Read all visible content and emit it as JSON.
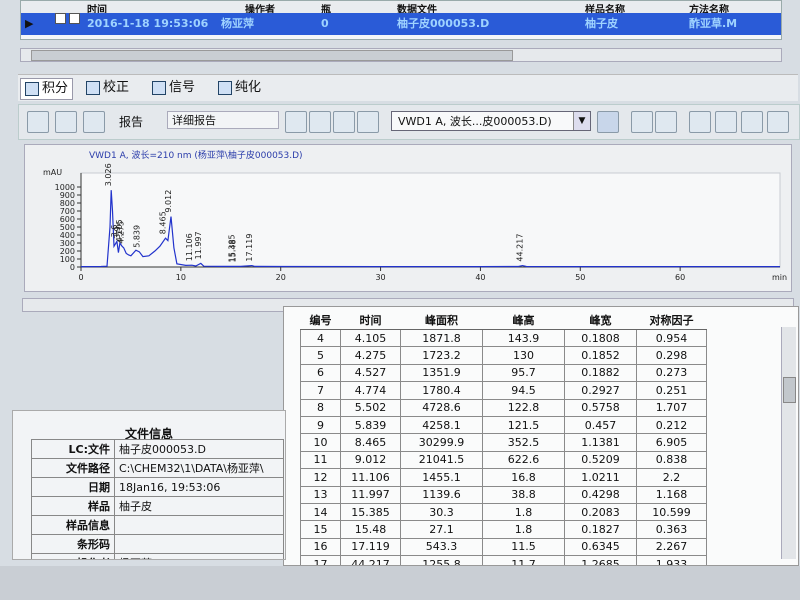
{
  "top_table": {
    "headers": [
      "时间",
      "操作者",
      "瓶",
      "数据文件",
      "样品名称",
      "方法名称"
    ],
    "row": {
      "time": "2016-1-18 19:53:06",
      "operator": "杨亚萍",
      "vial": "0",
      "file": "柚子皮000053.D",
      "sample": "柚子皮",
      "method": "酢亚草.M"
    }
  },
  "tabs": [
    {
      "label": "积分"
    },
    {
      "label": "校正"
    },
    {
      "label": "信号"
    },
    {
      "label": "纯化"
    }
  ],
  "toolbar": {
    "report_label": "报告",
    "report_value": "详细报告",
    "signal_value": "VWD1 A, 波长...皮000053.D)"
  },
  "chart_data": {
    "type": "line",
    "title": "VWD1 A, 波长=210 nm (杨亚萍\\柚子皮000053.D)",
    "ylabel": "mAU",
    "xlabel": "min",
    "xlim": [
      0,
      70
    ],
    "ylim": [
      0,
      1100
    ],
    "xticks": [
      0,
      10,
      20,
      30,
      40,
      50,
      60
    ],
    "yticks": [
      0,
      100,
      200,
      300,
      400,
      500,
      600,
      700,
      800,
      900,
      1000
    ],
    "peak_labels": [
      {
        "t": 3.026,
        "label": "3.026"
      },
      {
        "t": 3.6,
        "label": "3.6"
      },
      {
        "t": 3.9,
        "label": "3.9"
      },
      {
        "t": 4.105,
        "label": "4.105"
      },
      {
        "t": 4.275,
        "label": "4.275"
      },
      {
        "t": 5.839,
        "label": "5.839"
      },
      {
        "t": 8.465,
        "label": "8.465"
      },
      {
        "t": 9.012,
        "label": "9.012"
      },
      {
        "t": 11.106,
        "label": "11.106"
      },
      {
        "t": 11.997,
        "label": "11.997"
      },
      {
        "t": 15.385,
        "label": "15.385"
      },
      {
        "t": 15.48,
        "label": "15.48"
      },
      {
        "t": 17.119,
        "label": "17.119"
      },
      {
        "t": 44.217,
        "label": "44.217"
      }
    ],
    "trace": [
      [
        0,
        5
      ],
      [
        2,
        6
      ],
      [
        2.6,
        10
      ],
      [
        2.9,
        500
      ],
      [
        3.026,
        960
      ],
      [
        3.15,
        700
      ],
      [
        3.3,
        260
      ],
      [
        3.6,
        320
      ],
      [
        3.75,
        180
      ],
      [
        3.9,
        300
      ],
      [
        4.105,
        260
      ],
      [
        4.275,
        240
      ],
      [
        4.527,
        170
      ],
      [
        4.774,
        150
      ],
      [
        5.0,
        140
      ],
      [
        5.502,
        210
      ],
      [
        5.839,
        190
      ],
      [
        6.2,
        130
      ],
      [
        6.8,
        140
      ],
      [
        7.4,
        200
      ],
      [
        7.9,
        260
      ],
      [
        8.465,
        360
      ],
      [
        8.7,
        330
      ],
      [
        9.012,
        630
      ],
      [
        9.3,
        240
      ],
      [
        9.6,
        40
      ],
      [
        10.5,
        20
      ],
      [
        11.106,
        22
      ],
      [
        11.5,
        12
      ],
      [
        11.997,
        45
      ],
      [
        12.3,
        10
      ],
      [
        14,
        8
      ],
      [
        15.385,
        8
      ],
      [
        15.48,
        8
      ],
      [
        16,
        8
      ],
      [
        17.119,
        18
      ],
      [
        17.4,
        8
      ],
      [
        20,
        6
      ],
      [
        30,
        5
      ],
      [
        40,
        5
      ],
      [
        43.8,
        6
      ],
      [
        44.217,
        18
      ],
      [
        44.6,
        6
      ],
      [
        50,
        5
      ],
      [
        60,
        5
      ],
      [
        70,
        5
      ]
    ]
  },
  "peak_table": {
    "headers": [
      "编号",
      "时间",
      "峰面积",
      "峰高",
      "峰宽",
      "对称因子"
    ],
    "rows": [
      [
        "4",
        "4.105",
        "1871.8",
        "143.9",
        "0.1808",
        "0.954"
      ],
      [
        "5",
        "4.275",
        "1723.2",
        "130",
        "0.1852",
        "0.298"
      ],
      [
        "6",
        "4.527",
        "1351.9",
        "95.7",
        "0.1882",
        "0.273"
      ],
      [
        "7",
        "4.774",
        "1780.4",
        "94.5",
        "0.2927",
        "0.251"
      ],
      [
        "8",
        "5.502",
        "4728.6",
        "122.8",
        "0.5758",
        "1.707"
      ],
      [
        "9",
        "5.839",
        "4258.1",
        "121.5",
        "0.457",
        "0.212"
      ],
      [
        "10",
        "8.465",
        "30299.9",
        "352.5",
        "1.1381",
        "6.905"
      ],
      [
        "11",
        "9.012",
        "21041.5",
        "622.6",
        "0.5209",
        "0.838"
      ],
      [
        "12",
        "11.106",
        "1455.1",
        "16.8",
        "1.0211",
        "2.2"
      ],
      [
        "13",
        "11.997",
        "1139.6",
        "38.8",
        "0.4298",
        "1.168"
      ],
      [
        "14",
        "15.385",
        "30.3",
        "1.8",
        "0.2083",
        "10.599"
      ],
      [
        "15",
        "15.48",
        "27.1",
        "1.8",
        "0.1827",
        "0.363"
      ],
      [
        "16",
        "17.119",
        "543.3",
        "11.5",
        "0.6345",
        "2.267"
      ],
      [
        "17",
        "44.217",
        "1255.8",
        "11.7",
        "1.2685",
        "1.933"
      ]
    ]
  },
  "file_info": {
    "title": "文件信息",
    "rows": [
      {
        "k": "LC:文件",
        "v": "柚子皮000053.D"
      },
      {
        "k": "文件路径",
        "v": "C:\\CHEM32\\1\\DATA\\杨亚萍\\"
      },
      {
        "k": "日期",
        "v": "18Jan16, 19:53:06"
      },
      {
        "k": "样品",
        "v": "柚子皮"
      },
      {
        "k": "样品信息",
        "v": ""
      },
      {
        "k": "条形码",
        "v": ""
      },
      {
        "k": "操作者",
        "v": "杨亚萍"
      }
    ]
  }
}
